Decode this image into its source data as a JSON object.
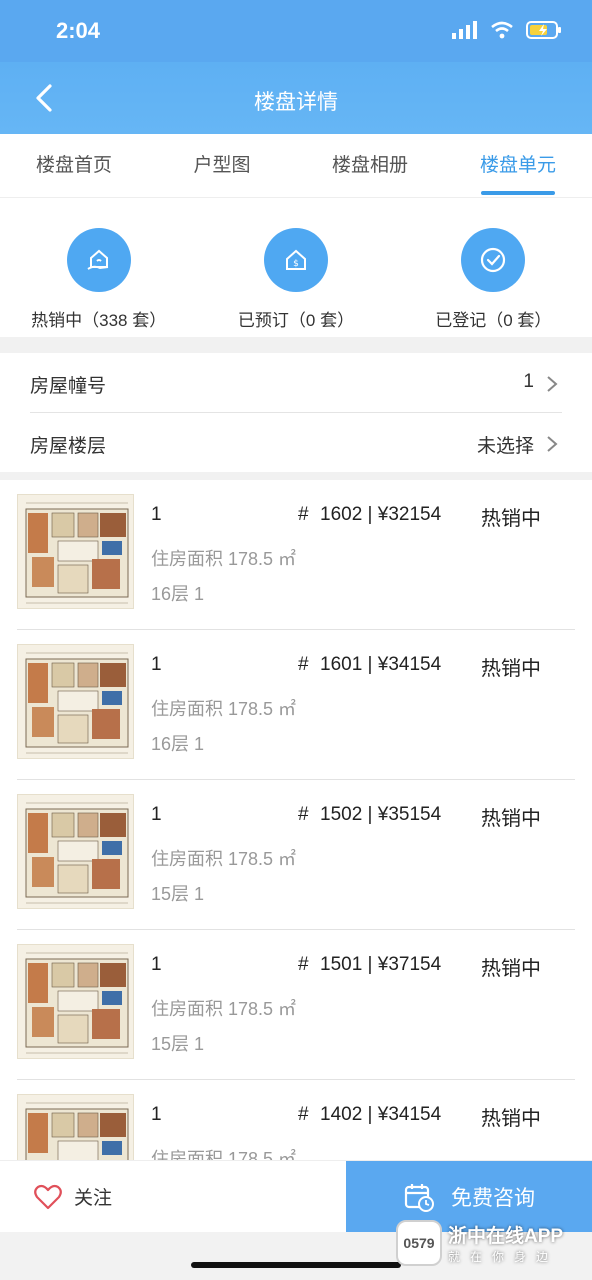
{
  "status_bar": {
    "time": "2:04"
  },
  "nav": {
    "title": "楼盘详情"
  },
  "tabs": [
    {
      "label": "楼盘首页",
      "active": false
    },
    {
      "label": "户型图",
      "active": false
    },
    {
      "label": "楼盘相册",
      "active": false
    },
    {
      "label": "楼盘单元",
      "active": true
    }
  ],
  "stats": [
    {
      "label": "热销中（338 套）",
      "icon": "house-hand-icon"
    },
    {
      "label": "已预订（0 套）",
      "icon": "house-dollar-icon"
    },
    {
      "label": "已登记（0 套）",
      "icon": "check-circle-icon"
    }
  ],
  "filters": {
    "building": {
      "label": "房屋幢号",
      "value": "1"
    },
    "floor": {
      "label": "房屋楼层",
      "value": "未选择"
    }
  },
  "units": [
    {
      "building": "1",
      "hash": "#",
      "room_price": "1602 | ¥32154",
      "status": "热销中",
      "area": "住房面积 178.5 ㎡",
      "floor": "16层 1"
    },
    {
      "building": "1",
      "hash": "#",
      "room_price": "1601 | ¥34154",
      "status": "热销中",
      "area": "住房面积 178.5 ㎡",
      "floor": "16层 1"
    },
    {
      "building": "1",
      "hash": "#",
      "room_price": "1502 | ¥35154",
      "status": "热销中",
      "area": "住房面积 178.5 ㎡",
      "floor": "15层 1"
    },
    {
      "building": "1",
      "hash": "#",
      "room_price": "1501 | ¥37154",
      "status": "热销中",
      "area": "住房面积 178.5 ㎡",
      "floor": "15层 1"
    },
    {
      "building": "1",
      "hash": "#",
      "room_price": "1402 | ¥34154",
      "status": "热销中",
      "area": "住房面积 178.5 ㎡",
      "floor": ""
    }
  ],
  "bottom": {
    "follow_label": "关注",
    "consult_label": "免费咨询"
  },
  "watermark": {
    "title": "浙中在线APP",
    "subtitle": "就在你身边",
    "logo": "0579"
  },
  "colors": {
    "primary": "#5aa8f0",
    "active_tab": "#3a9be8"
  }
}
